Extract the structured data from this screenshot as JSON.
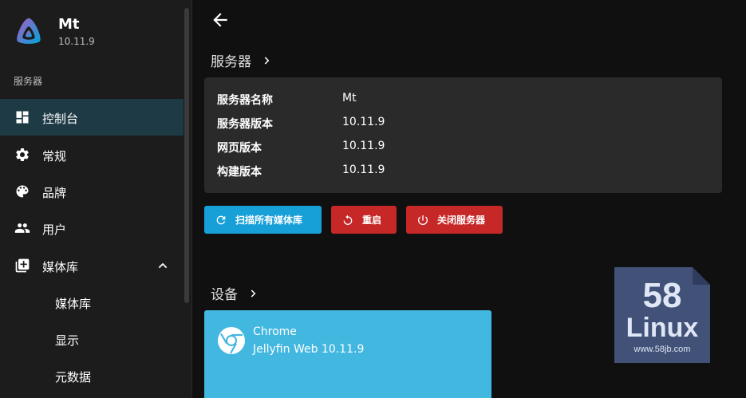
{
  "app": {
    "name": "Mt",
    "version": "10.11.9"
  },
  "sidebar": {
    "section_label": "服务器",
    "items": [
      {
        "label": "控制台",
        "icon": "dashboard-icon",
        "active": true
      },
      {
        "label": "常规",
        "icon": "gear-icon"
      },
      {
        "label": "品牌",
        "icon": "palette-icon"
      },
      {
        "label": "用户",
        "icon": "people-icon"
      },
      {
        "label": "媒体库",
        "icon": "library-add-icon",
        "expanded": true
      }
    ],
    "sub_items": [
      {
        "label": "媒体库"
      },
      {
        "label": "显示"
      },
      {
        "label": "元数据"
      }
    ]
  },
  "server_section": {
    "title": "服务器",
    "rows": [
      {
        "key": "服务器名称",
        "value": "Mt"
      },
      {
        "key": "服务器版本",
        "value": "10.11.9"
      },
      {
        "key": "网页版本",
        "value": "10.11.9"
      },
      {
        "key": "构建版本",
        "value": "10.11.9"
      }
    ],
    "buttons": {
      "scan": "扫描所有媒体库",
      "restart": "重启",
      "shutdown": "关闭服务器"
    }
  },
  "devices_section": {
    "title": "设备",
    "devices": [
      {
        "name": "Chrome",
        "client": "Jellyfin Web 10.11.9",
        "icon": "chrome-icon"
      }
    ]
  },
  "watermark": {
    "line1": "58",
    "line2": "Linux",
    "line3": "www.58jb.com"
  },
  "colors": {
    "accent": "#17a0d8",
    "danger": "#c62828",
    "active_nav": "#1e3a45",
    "device_card": "#42b7e0",
    "card_bg": "#2a2a2a"
  }
}
